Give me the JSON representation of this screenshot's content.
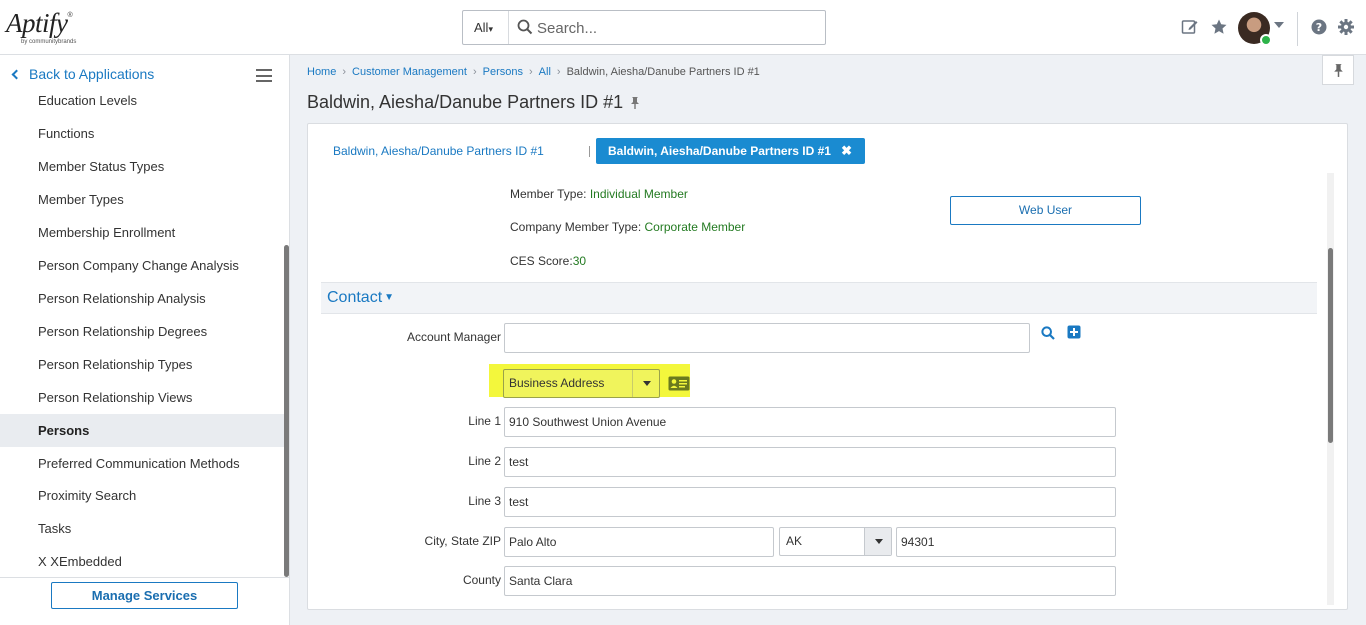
{
  "topbar": {
    "logo_text": "Aptify",
    "logo_sub": "by communitybrands",
    "search_scope": "All",
    "search_placeholder": "Search..."
  },
  "sidebar": {
    "back_label": "Back to Applications",
    "items": [
      {
        "label": "Education Levels"
      },
      {
        "label": "Functions"
      },
      {
        "label": "Member Status Types"
      },
      {
        "label": "Member Types"
      },
      {
        "label": "Membership Enrollment"
      },
      {
        "label": "Person Company Change Analysis"
      },
      {
        "label": "Person Relationship Analysis"
      },
      {
        "label": "Person Relationship Degrees"
      },
      {
        "label": "Person Relationship Types"
      },
      {
        "label": "Person Relationship Views"
      },
      {
        "label": "Persons",
        "active": true
      },
      {
        "label": "Preferred Communication Methods"
      },
      {
        "label": "Proximity Search"
      },
      {
        "label": "Tasks"
      },
      {
        "label": "X XEmbedded"
      }
    ],
    "manage_services_label": "Manage Services"
  },
  "breadcrumb": {
    "items": [
      "Home",
      "Customer Management",
      "Persons",
      "All"
    ],
    "current": "Baldwin, Aiesha/Danube Partners ID #1"
  },
  "page": {
    "title": "Baldwin, Aiesha/Danube Partners ID #1"
  },
  "tabs": {
    "tab1_label": "Baldwin, Aiesha/Danube Partners ID #1",
    "tab2_label": "Baldwin, Aiesha/Danube Partners ID #1",
    "close_glyph": "✖"
  },
  "record": {
    "member_type_label": "Member Type:",
    "member_type_value": "Individual Member",
    "company_member_type_label": "Company Member Type:",
    "company_member_type_value": "Corporate Member",
    "ces_score_label": "CES Score:",
    "ces_score_value": "30",
    "web_user_label": "Web User"
  },
  "contact": {
    "section_title": "Contact",
    "account_manager_label": "Account Manager",
    "account_manager_value": "",
    "address_type": "Business Address",
    "line1_label": "Line 1",
    "line1_value": "910 Southwest Union Avenue",
    "line2_label": "Line 2",
    "line2_value": "test",
    "line3_label": "Line 3",
    "line3_value": "test",
    "city_state_zip_label": "City, State ZIP",
    "city_value": "Palo Alto",
    "state_value": "AK",
    "zip_value": "94301",
    "county_label": "County",
    "county_value": "Santa Clara"
  },
  "colors": {
    "accent": "#1a79c2",
    "tab_active": "#1a8bd1",
    "value_green": "#237a21",
    "highlight": "#f3f73c"
  }
}
